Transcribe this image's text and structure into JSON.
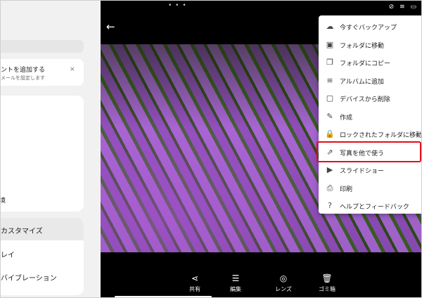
{
  "left_panel": {
    "notice_title": "ントを追加する",
    "notice_subtitle": "メールを設定します",
    "notice_close": "×",
    "card_fragment": "境",
    "customize_label": "カスタマイズ",
    "item_1": "レイ",
    "item_2": "バイブレーション"
  },
  "status_bar": {
    "dots": "• • •",
    "icons": [
      "do-not-disturb-icon",
      "wifi-icon",
      "battery-icon"
    ],
    "glyphs": [
      "⊘",
      "≋",
      "▭"
    ]
  },
  "toolbar": {
    "back_glyph": "←"
  },
  "bottom_actions": [
    {
      "label": "共有",
      "icon": "share-icon",
      "glyph": "⋖"
    },
    {
      "label": "編集",
      "icon": "edit-sliders-icon",
      "glyph": "☰"
    },
    {
      "label": "レンズ",
      "icon": "lens-icon",
      "glyph": "◎"
    },
    {
      "label": "ゴミ箱",
      "icon": "trash-icon",
      "glyph": "🗑"
    }
  ],
  "menu": {
    "items": [
      {
        "label": "今すぐバックアップ",
        "icon": "cloud-upload-icon",
        "glyph": "☁"
      },
      {
        "label": "フォルダに移動",
        "icon": "folder-move-icon",
        "glyph": "▣"
      },
      {
        "label": "フォルダにコピー",
        "icon": "folder-copy-icon",
        "glyph": "❐"
      },
      {
        "label": "アルバムに追加",
        "icon": "playlist-add-icon",
        "glyph": "≡"
      },
      {
        "label": "デバイスから削除",
        "icon": "delete-from-device-icon",
        "glyph": "▢"
      },
      {
        "label": "作成",
        "icon": "pen-icon",
        "glyph": "✎"
      },
      {
        "label": "ロックされたフォルダに移動",
        "icon": "lock-icon",
        "glyph": "🔒"
      },
      {
        "label": "写真を他で使う",
        "icon": "open-external-icon",
        "glyph": "⇗"
      },
      {
        "label": "スライドショー",
        "icon": "slideshow-icon",
        "glyph": "▶"
      },
      {
        "label": "印刷",
        "icon": "print-icon",
        "glyph": "⎙"
      },
      {
        "label": "ヘルプとフィードバック",
        "icon": "help-icon",
        "glyph": "?"
      }
    ],
    "highlighted_item": "写真を他で使う",
    "highlight_color": "#e30f17"
  },
  "colors": {
    "panel_bg": "#f1f1f1",
    "app_bg": "#000000",
    "menu_bg": "#ffffff"
  }
}
